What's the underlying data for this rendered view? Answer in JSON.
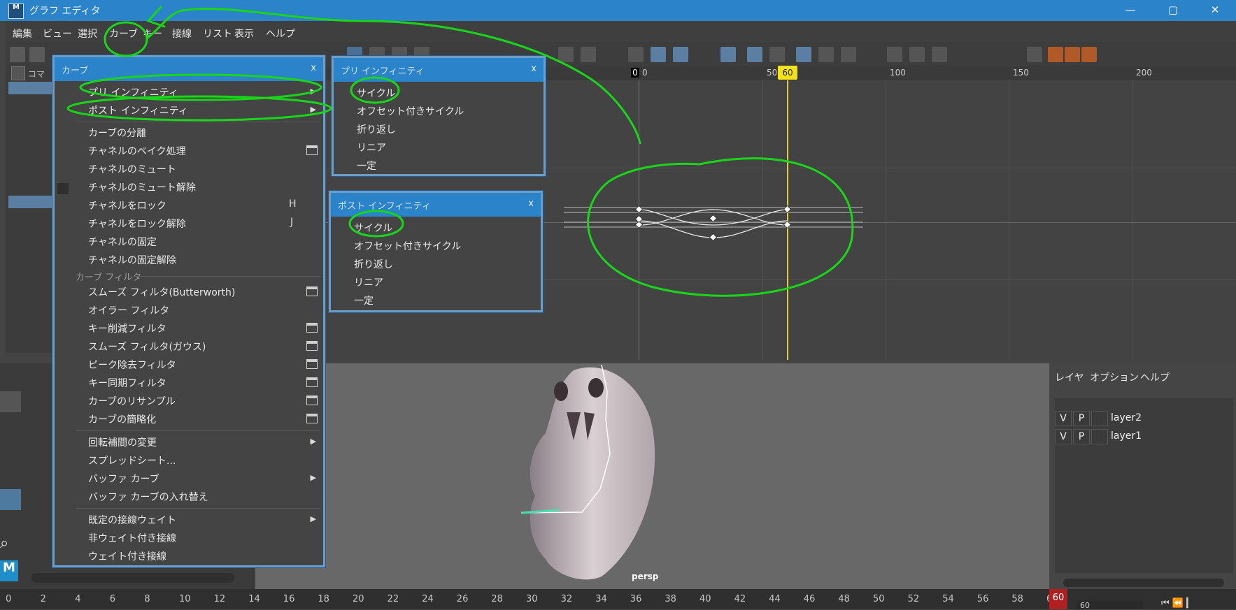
{
  "window": {
    "title": "グラフ エディタ",
    "logo_text": "M",
    "buttons": [
      "—",
      "▢",
      "✕"
    ]
  },
  "menubar": [
    "編集",
    "ビュー",
    "選択",
    "カーブ",
    "キー",
    "接線",
    "リスト",
    "表示",
    "ヘルプ"
  ],
  "outliner": {
    "command_label": "コマ"
  },
  "ruler": {
    "labels": [
      "0",
      "0",
      "50",
      "60",
      "100",
      "150",
      "200"
    ],
    "current_frame": "60"
  },
  "curve_menu": {
    "title": "カーブ",
    "close": "x",
    "items": {
      "pre_infinity": "プリ インフィニティ",
      "post_infinity": "ポスト インフィニティ",
      "separate": "カーブの分離",
      "bake_channel": "チャネルのベイク処理",
      "mute_channel": "チャネルのミュート",
      "unmute_channel": "チャネルのミュート解除",
      "lock_channel": "チャネルをロック",
      "lock_shortcut": "H",
      "unlock_channel": "チャネルをロック解除",
      "unlock_shortcut": "J",
      "fix_channel": "チャネルの固定",
      "unfix_channel": "チャネルの固定解除",
      "filter_section": "カーブ フィルタ",
      "smooth_butterworth": "スムーズ フィルタ(Butterworth)",
      "euler_filter": "オイラー フィルタ",
      "key_reduce": "キー削減フィルタ",
      "smooth_gauss": "スムーズ フィルタ(ガウス)",
      "peak_remove": "ピーク除去フィルタ",
      "key_sync": "キー同期フィルタ",
      "resample": "カーブのリサンプル",
      "simplify": "カーブの簡略化",
      "rotation_interp": "回転補間の変更",
      "spreadsheet": "スプレッドシート...",
      "buffer_curve": "バッファ カーブ",
      "swap_buffer": "バッファ カーブの入れ替え",
      "default_tangent_weight": "既定の接線ウェイト",
      "non_weighted": "非ウェイト付き接線",
      "weighted": "ウェイト付き接線"
    }
  },
  "pre_infinity_menu": {
    "title": "プリ インフィニティ",
    "close": "x",
    "items": [
      "サイクル",
      "オフセット付きサイクル",
      "折り返し",
      "リニア",
      "一定"
    ]
  },
  "post_infinity_menu": {
    "title": "ポスト インフィニティ",
    "close": "x",
    "items": [
      "サイクル",
      "オフセット付きサイクル",
      "折り返し",
      "リニア",
      "一定"
    ]
  },
  "layer_panel": {
    "menu": [
      "レイヤ",
      "オプション",
      "ヘルプ"
    ],
    "layers": [
      {
        "v": "V",
        "p": "P",
        "name": "layer2"
      },
      {
        "v": "V",
        "p": "P",
        "name": "layer1"
      }
    ]
  },
  "viewport": {
    "camera": "persp"
  },
  "timeline": {
    "ticks": [
      "0",
      "2",
      "4",
      "6",
      "8",
      "10",
      "12",
      "14",
      "16",
      "18",
      "20",
      "22",
      "24",
      "26",
      "28",
      "30",
      "32",
      "34",
      "36",
      "38",
      "40",
      "42",
      "44",
      "46",
      "48",
      "50",
      "52",
      "54",
      "56",
      "58",
      "60"
    ],
    "current": "60",
    "field_value": "60"
  },
  "annotation_color": "#19d619",
  "accent_color": "#2b83c9"
}
